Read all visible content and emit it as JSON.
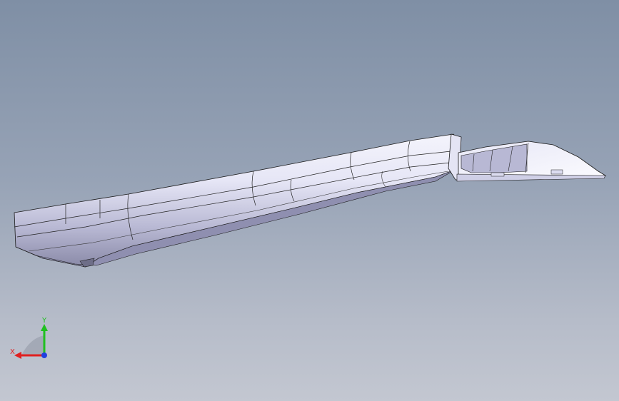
{
  "viewport": {
    "background_top": "#7f8fa5",
    "background_bottom": "#c3c7d1",
    "part_color": "#d9d9f2",
    "edge_color": "#1a1a1a"
  },
  "triad": {
    "x_label": "X",
    "y_label": "Y",
    "x_color": "#e02020",
    "y_color": "#20c020",
    "z_color": "#2040e0"
  }
}
